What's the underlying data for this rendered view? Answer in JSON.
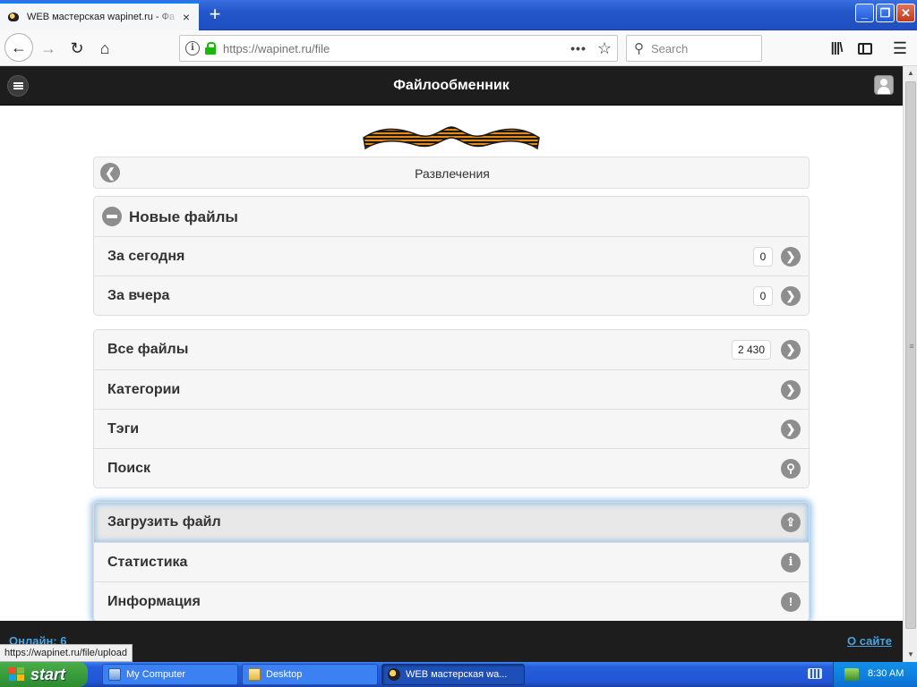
{
  "browser": {
    "tab_title": "WEB мастерская wapinet.ru - Фа",
    "tab_close": "×",
    "new_tab": "+",
    "window_buttons": {
      "minimize": "_",
      "restore": "❐",
      "close": "✕"
    },
    "nav": {
      "back": "←",
      "forward": "→",
      "reload": "↻",
      "home": "⌂"
    },
    "url": "https://wapinet.ru/file",
    "page_actions": "•••",
    "bookmark": "☆",
    "search_placeholder": "Search",
    "search_icon": "⚲",
    "library": "|||\\",
    "menu": "☰"
  },
  "site": {
    "title": "Файлообменник",
    "breadcrumb": "Развлечения",
    "back_glyph": "❮",
    "new_files": {
      "header": "Новые файлы",
      "items": [
        {
          "label": "За сегодня",
          "count": "0"
        },
        {
          "label": "За вчера",
          "count": "0"
        }
      ]
    },
    "browse": [
      {
        "label": "Все файлы",
        "count": "2 430",
        "icon": "arrow-right"
      },
      {
        "label": "Категории",
        "icon": "arrow-right"
      },
      {
        "label": "Тэги",
        "icon": "arrow-right"
      },
      {
        "label": "Поиск",
        "icon": "search"
      }
    ],
    "actions": [
      {
        "label": "Загрузить файл",
        "icon": "upload",
        "active": true
      },
      {
        "label": "Статистика",
        "icon": "info"
      },
      {
        "label": "Информация",
        "icon": "alert"
      }
    ],
    "icons": {
      "arrow": "❯",
      "search": "⚲",
      "upload": "⇪",
      "info": "i",
      "alert": "!"
    },
    "footer": {
      "online": "Онлайн: 6",
      "about": "О сайте"
    },
    "status_url": "https://wapinet.ru/file/upload"
  },
  "taskbar": {
    "start": "start",
    "tasks": [
      "My Computer",
      "Desktop",
      "WEB мастерская wa..."
    ],
    "clock": "8:30 AM"
  },
  "colors": {
    "header_bg": "#1d1d1d",
    "link": "#4aa3df",
    "icon_gray": "#8e8e8e",
    "xp_blue": "#245edb",
    "xp_green": "#369a39"
  }
}
